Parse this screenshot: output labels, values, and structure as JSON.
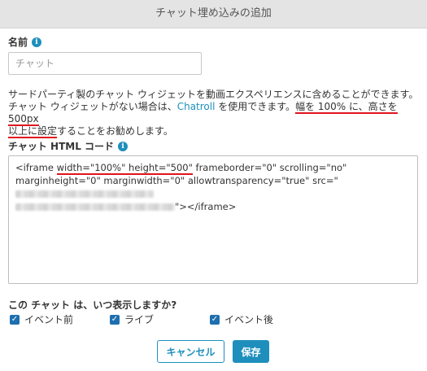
{
  "dialog": {
    "title": "チャット埋め込みの追加"
  },
  "name_field": {
    "label": "名前",
    "placeholder": "チャット",
    "value": ""
  },
  "description": {
    "part1": "サードパーティ製のチャット ウィジェットを動画エクスペリエンスに含めることができます。チャット ウィジェットがない場合は、",
    "link": "Chatroll",
    "part2": " を使用できます。",
    "highlight1": "幅を 100% に、高さを 500px",
    "highlight2": "以上に設定",
    "part3": "することをお勧めします。"
  },
  "code_field": {
    "label": "チャット HTML コード",
    "prefix": "<iframe ",
    "highlight": "width=\"100%\" height=\"500\"",
    "rest": " frameborder=\"0\" scrolling=\"no\" marginheight=\"0\" marginwidth=\"0\" allowtransparency=\"true\" src=\"",
    "suffix": "\"></iframe>"
  },
  "display_when": {
    "label": "この チャット は、いつ表示しますか?",
    "options": [
      {
        "label": "イベント前",
        "checked": true
      },
      {
        "label": "ライブ",
        "checked": true
      },
      {
        "label": "イベント後",
        "checked": true
      }
    ]
  },
  "buttons": {
    "cancel": "キャンセル",
    "save": "保存"
  },
  "colors": {
    "accent": "#1e8fbd",
    "checkbox": "#1e6fb0",
    "annotation": "#e0141e",
    "titlebar": "#e4e4e4"
  }
}
